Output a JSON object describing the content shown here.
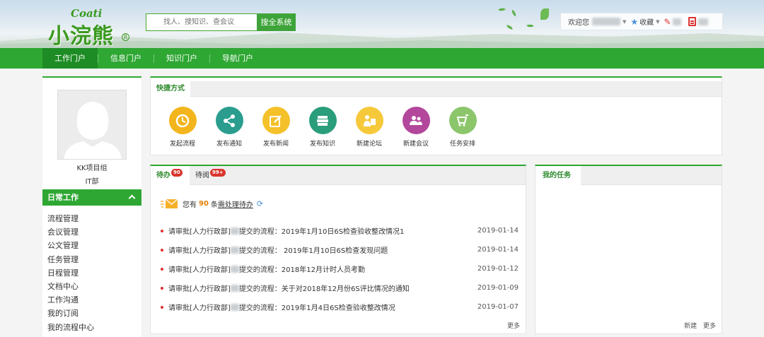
{
  "header": {
    "logo_en": "Coati",
    "logo_cn": "小浣熊",
    "logo_reg": "R",
    "search_placeholder": "找人、搜知识、查会议",
    "search_button": "搜全系统",
    "welcome": "欢迎您",
    "favorites": "收藏"
  },
  "nav": {
    "items": [
      {
        "label": "工作门户",
        "active": true
      },
      {
        "label": "信息门户",
        "active": false
      },
      {
        "label": "知识门户",
        "active": false
      },
      {
        "label": "导航门户",
        "active": false
      }
    ]
  },
  "sidebar": {
    "user_group": "KK项目组",
    "user_dept": "IT部",
    "section_title": "日常工作",
    "menu": [
      "流程管理",
      "会议管理",
      "公文管理",
      "任务管理",
      "日程管理",
      "文档中心",
      "工作沟通",
      "我的订阅",
      "我的流程中心"
    ]
  },
  "shortcuts": {
    "title": "快捷方式",
    "items": [
      {
        "label": "发起流程",
        "icon": "flow-icon",
        "color": "#f3b51c"
      },
      {
        "label": "发布通知",
        "icon": "share-icon",
        "color": "#2a9d8f"
      },
      {
        "label": "发布新闻",
        "icon": "edit-icon",
        "color": "#f4c12a"
      },
      {
        "label": "发布知识",
        "icon": "books-icon",
        "color": "#2a9d7a"
      },
      {
        "label": "新建论坛",
        "icon": "forum-icon",
        "color": "#f6c93b"
      },
      {
        "label": "新建会议",
        "icon": "meeting-icon",
        "color": "#b2479b"
      },
      {
        "label": "任务安排",
        "icon": "task-icon",
        "color": "#8cc66b"
      }
    ]
  },
  "todo": {
    "tab_todo": "待办",
    "tab_todo_badge": "90",
    "tab_toread": "待阅",
    "tab_toread_badge": "99+",
    "notice_prefix": "您有",
    "notice_count": "90",
    "notice_mid": "条",
    "notice_link": "需处理待办",
    "rows": [
      {
        "prefix": "请审批[人力行政部]",
        "suffix": "提交的流程：2019年1月10日6S检查验收整改情况1",
        "date": "2019-01-14"
      },
      {
        "prefix": "请审批[人力行政部]",
        "suffix": "提交的流程： 2019年1月10日6S检查发现问题",
        "date": "2019-01-14"
      },
      {
        "prefix": "请审批[人力行政部]",
        "suffix": "提交的流程：2018年12月计时人员考勤",
        "date": "2019-01-12"
      },
      {
        "prefix": "请审批[人力行政部]",
        "suffix": "提交的流程：关于对2018年12月份6S评比情况的通知",
        "date": "2019-01-09"
      },
      {
        "prefix": "请审批[人力行政部]",
        "suffix": "提交的流程：2019年1月4日6S检查验收整改情况",
        "date": "2019-01-07"
      }
    ],
    "more": "更多"
  },
  "tasks": {
    "title": "我的任务",
    "new": "新建",
    "more": "更多"
  }
}
